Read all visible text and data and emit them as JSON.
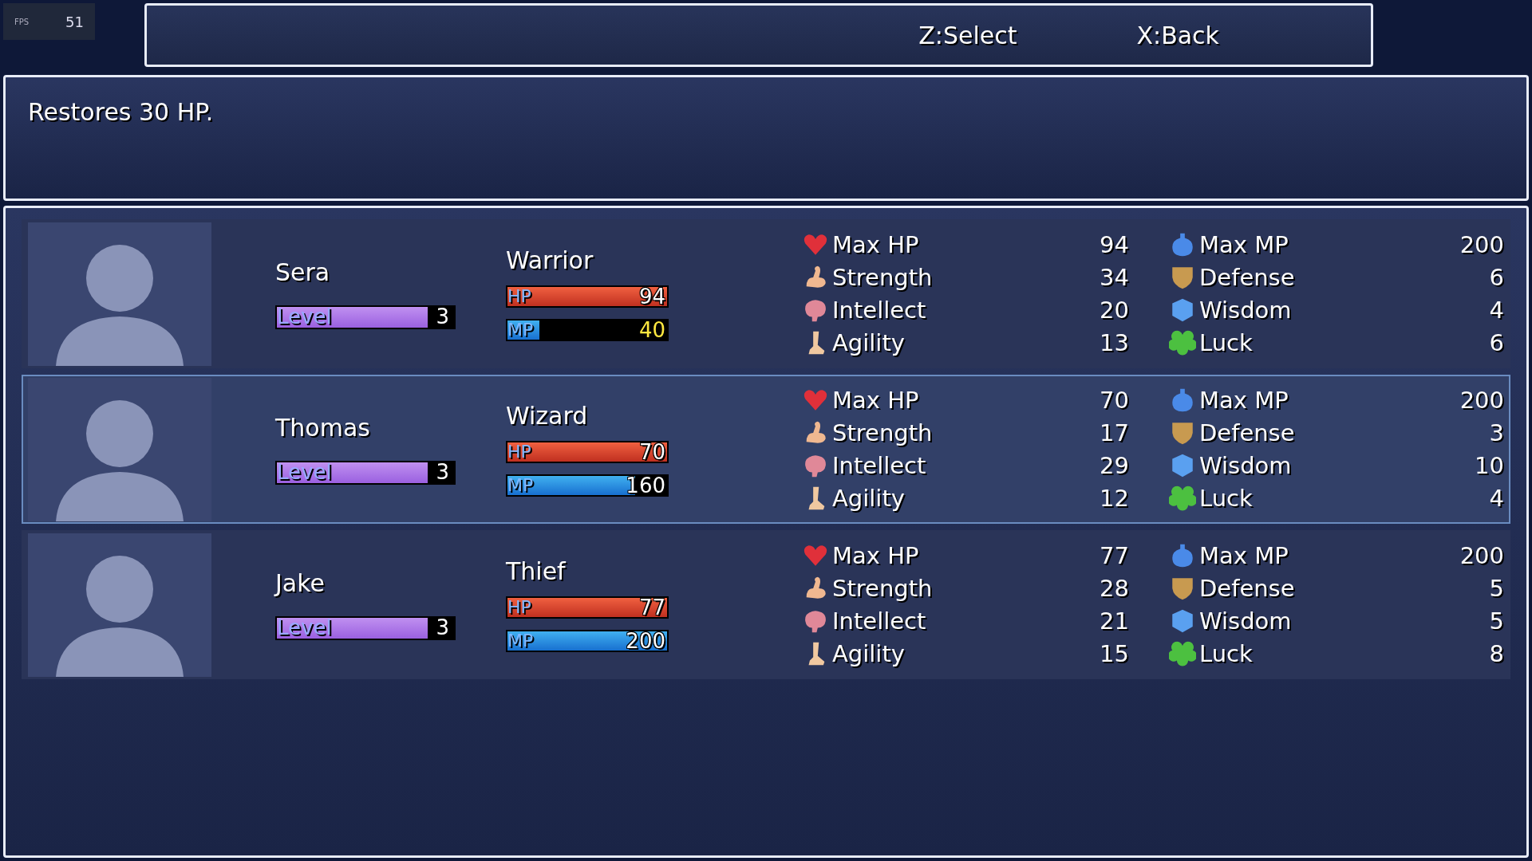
{
  "fps": {
    "label": "FPS",
    "value": "51"
  },
  "help_bar": {
    "keys": [
      "Z:Select",
      "X:Back"
    ]
  },
  "description": "Restores 30 HP.",
  "party": [
    {
      "name": "Sera",
      "class": "Warrior",
      "selected": false,
      "level_label": "Level",
      "level_value": "3",
      "exp": {
        "level": 0.85
      },
      "hp": {
        "label": "HP",
        "value": "94",
        "level": 1,
        "warning": false
      },
      "mp": {
        "label": "MP",
        "value": "40",
        "level": 0.2,
        "warning": true
      },
      "stats": [
        {
          "kind": "hp",
          "label": "Max HP",
          "value": "94"
        },
        {
          "kind": "str",
          "label": "Strength",
          "value": "34"
        },
        {
          "kind": "int",
          "label": "Intellect",
          "value": "20"
        },
        {
          "kind": "agi",
          "label": "Agility",
          "value": "13"
        },
        {
          "kind": "mp",
          "label": "Max MP",
          "value": "200"
        },
        {
          "kind": "def",
          "label": "Defense",
          "value": "6"
        },
        {
          "kind": "wis",
          "label": "Wisdom",
          "value": "4"
        },
        {
          "kind": "luck",
          "label": "Luck",
          "value": "6"
        }
      ]
    },
    {
      "name": "Thomas",
      "class": "Wizard",
      "selected": true,
      "level_label": "Level",
      "level_value": "3",
      "exp": {
        "level": 0.85
      },
      "hp": {
        "label": "HP",
        "value": "70",
        "level": 1,
        "warning": false
      },
      "mp": {
        "label": "MP",
        "value": "160",
        "level": 0.8,
        "warning": false
      },
      "stats": [
        {
          "kind": "hp",
          "label": "Max HP",
          "value": "70"
        },
        {
          "kind": "str",
          "label": "Strength",
          "value": "17"
        },
        {
          "kind": "int",
          "label": "Intellect",
          "value": "29"
        },
        {
          "kind": "agi",
          "label": "Agility",
          "value": "12"
        },
        {
          "kind": "mp",
          "label": "Max MP",
          "value": "200"
        },
        {
          "kind": "def",
          "label": "Defense",
          "value": "3"
        },
        {
          "kind": "wis",
          "label": "Wisdom",
          "value": "10"
        },
        {
          "kind": "luck",
          "label": "Luck",
          "value": "4"
        }
      ]
    },
    {
      "name": "Jake",
      "class": "Thief",
      "selected": false,
      "level_label": "Level",
      "level_value": "3",
      "exp": {
        "level": 0.85
      },
      "hp": {
        "label": "HP",
        "value": "77",
        "level": 1,
        "warning": false
      },
      "mp": {
        "label": "MP",
        "value": "200",
        "level": 1,
        "warning": false
      },
      "stats": [
        {
          "kind": "hp",
          "label": "Max HP",
          "value": "77"
        },
        {
          "kind": "str",
          "label": "Strength",
          "value": "28"
        },
        {
          "kind": "int",
          "label": "Intellect",
          "value": "21"
        },
        {
          "kind": "agi",
          "label": "Agility",
          "value": "15"
        },
        {
          "kind": "mp",
          "label": "Max MP",
          "value": "200"
        },
        {
          "kind": "def",
          "label": "Defense",
          "value": "5"
        },
        {
          "kind": "wis",
          "label": "Wisdom",
          "value": "5"
        },
        {
          "kind": "luck",
          "label": "Luck",
          "value": "8"
        }
      ]
    }
  ]
}
